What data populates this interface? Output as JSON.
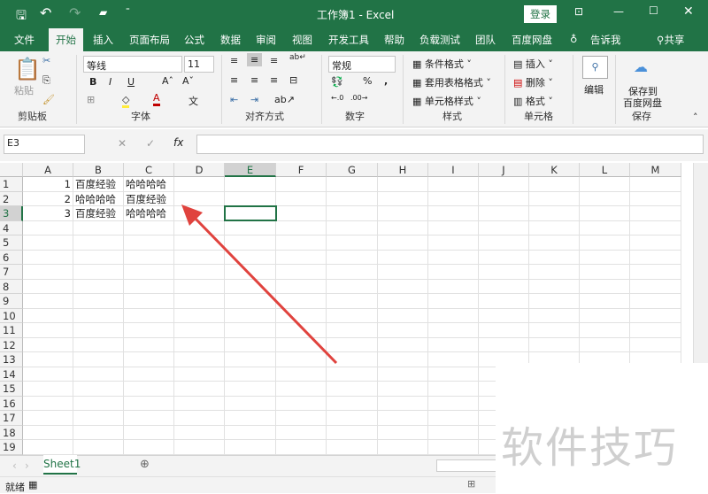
{
  "title": "工作簿1  -  Excel",
  "login": "登录",
  "tabs": [
    "文件",
    "开始",
    "插入",
    "页面布局",
    "公式",
    "数据",
    "审阅",
    "视图",
    "开发工具",
    "帮助",
    "负载测试",
    "团队",
    "百度网盘"
  ],
  "tell_me": "告诉我",
  "share": "共享",
  "ribbon": {
    "paste": "粘贴",
    "clipboard": "剪贴板",
    "font_name": "等线",
    "font_size": "11",
    "font_group": "字体",
    "bold": "B",
    "italic": "I",
    "underline": "U",
    "align_group": "对齐方式",
    "number_format": "常规",
    "number_group": "数字",
    "percent": "%",
    "comma": ",",
    "cond_format": "条件格式",
    "table_format": "套用表格格式",
    "cell_style": "单元格样式",
    "styles_group": "样式",
    "insert": "插入",
    "delete": "删除",
    "format": "格式",
    "cells_group": "单元格",
    "edit": "编辑",
    "save_to": "保存到",
    "baidu_pan": "百度网盘",
    "save_group": "保存"
  },
  "name_box": "E3",
  "formula": "",
  "columns": [
    "A",
    "B",
    "C",
    "D",
    "E",
    "F",
    "G",
    "H",
    "I",
    "J",
    "K",
    "L",
    "M"
  ],
  "rows": [
    "1",
    "2",
    "3",
    "4",
    "5",
    "6",
    "7",
    "8",
    "9",
    "10",
    "11",
    "12",
    "13",
    "14",
    "15",
    "16",
    "17",
    "18",
    "19"
  ],
  "cells": [
    [
      "1",
      "百度经验",
      "哈哈哈哈"
    ],
    [
      "2",
      "哈哈哈哈",
      "百度经验"
    ],
    [
      "3",
      "百度经验",
      "哈哈哈哈"
    ]
  ],
  "selected_cell": "E3",
  "sheet_tab": "Sheet1",
  "status": "就绪",
  "watermark": "软件技巧",
  "colors": {
    "brand": "#217346",
    "arrow": "#e0433e"
  }
}
